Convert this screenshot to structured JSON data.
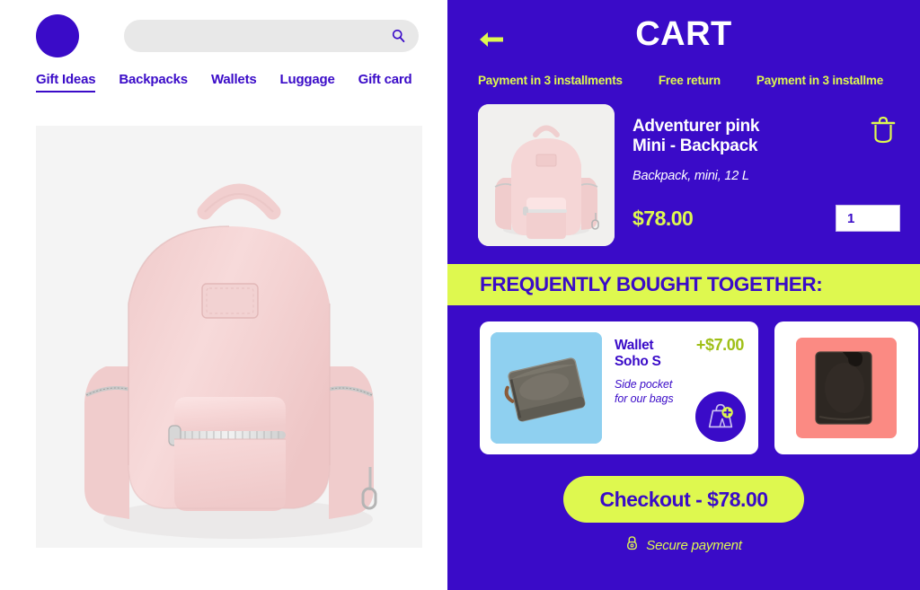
{
  "colors": {
    "purple": "#3A0BC8",
    "lime": "#DEF84F",
    "white": "#FFFFFF",
    "olive_price": "#9FBF16",
    "hero_bg": "#F4F4F4",
    "pink_bag": "#F3CFCF"
  },
  "store": {
    "logo_name": "brand-logo",
    "search": {
      "value": "",
      "placeholder": "",
      "icon": "search-icon"
    },
    "nav": [
      {
        "label": "Gift Ideas",
        "active": true
      },
      {
        "label": "Backpacks",
        "active": false
      },
      {
        "label": "Wallets",
        "active": false
      },
      {
        "label": "Luggage",
        "active": false
      },
      {
        "label": "Gift card",
        "active": false
      }
    ],
    "hero_alt": "Pink mini backpack product photo"
  },
  "cart": {
    "back_icon": "back-arrow-icon",
    "title": "CART",
    "marquee": [
      "Payment in 3 installments",
      "Free return",
      "Payment in 3 installme"
    ],
    "item": {
      "title_line1": "Adventurer pink",
      "title_line2": "Mini - Backpack",
      "subtitle": "Backpack, mini, 12 L",
      "price": "$78.00",
      "quantity": "1",
      "delete_icon": "trash-icon",
      "thumb_alt": "Pink mini backpack thumbnail"
    },
    "fbt": {
      "banner": "FREQUENTLY BOUGHT TOGETHER:",
      "cards": [
        {
          "name_line1": "Wallet",
          "name_line2": "Soho S",
          "desc_line1": "Side pocket",
          "desc_line2": "for our bags",
          "plus_price": "+$7.00",
          "add_icon": "add-to-bag-icon",
          "image_alt": "Gray wallet on blue background"
        },
        {
          "image_alt": "Black wallet on coral background"
        }
      ]
    },
    "checkout": {
      "label": "Checkout - $78.00",
      "secure_icon": "lock-icon",
      "secure_text": "Secure payment"
    }
  }
}
